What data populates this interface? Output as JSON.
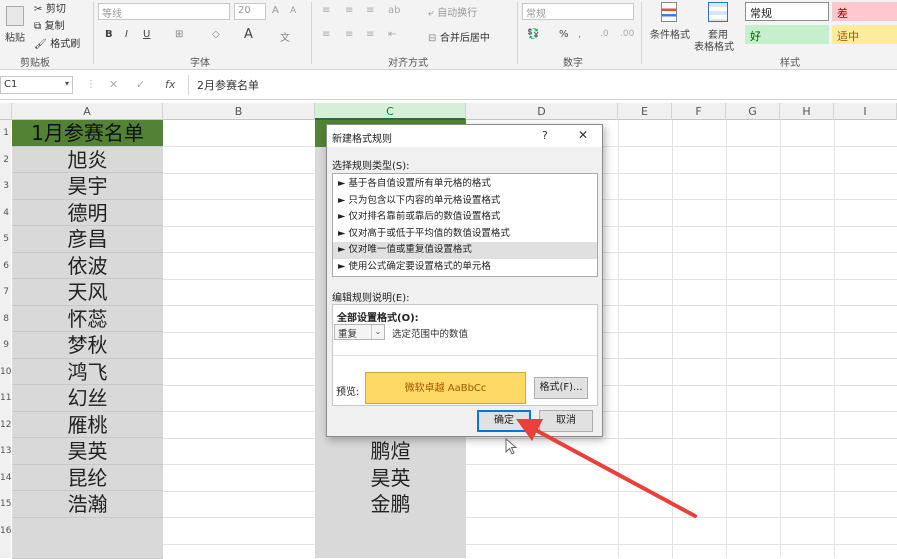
{
  "ribbon": {
    "clipboard": {
      "cut": "剪切",
      "copy": "复制",
      "format_painter": "格式刷",
      "paste": "粘贴",
      "group_label": "剪贴板"
    },
    "font": {
      "font_name": "等线",
      "font_size": "20",
      "group_label": "字体"
    },
    "alignment": {
      "wrap_text": "自动换行",
      "merge_center": "合并后居中",
      "group_label": "对齐方式"
    },
    "number": {
      "format": "常规",
      "percent": "%",
      "group_label": "数字"
    },
    "styles": {
      "conditional_formatting": "条件格式",
      "table_format_line1": "套用",
      "table_format_line2": "表格格式",
      "group_label": "样式",
      "cell_styles": [
        {
          "label": "常规",
          "bg": "#ffffff",
          "fg": "#222222"
        },
        {
          "label": "差",
          "bg": "#ffc7ce",
          "fg": "#9c0006"
        },
        {
          "label": "好",
          "bg": "#c6efce",
          "fg": "#006100"
        },
        {
          "label": "适中",
          "bg": "#ffeb9c",
          "fg": "#9c5700"
        }
      ]
    }
  },
  "formula_bar": {
    "name_box": "C1",
    "fx": "fx",
    "content": "2月参赛名单"
  },
  "columns": [
    "A",
    "B",
    "C",
    "D",
    "E",
    "F",
    "G",
    "H",
    "I"
  ],
  "rows": [
    "1",
    "2",
    "3",
    "4",
    "5",
    "6",
    "7",
    "8",
    "9",
    "10",
    "11",
    "12",
    "13",
    "14",
    "15",
    "16"
  ],
  "column_a": [
    "1月参赛名单",
    "旭炎",
    "昊宇",
    "德明",
    "彦昌",
    "依波",
    "天风",
    "怀蕊",
    "梦秋",
    "鸿飞",
    "幻丝",
    "雁桃",
    "昊英",
    "昆纶",
    "浩瀚"
  ],
  "column_c_visible": [
    "鹏煊",
    "昊英",
    "金鹏"
  ],
  "dialog": {
    "title": "新建格式规则",
    "help": "?",
    "close": "✕",
    "select_rule_type_label": "选择规则类型(S):",
    "rule_types": [
      "► 基于各自值设置所有单元格的格式",
      "► 只为包含以下内容的单元格设置格式",
      "► 仅对排名靠前或靠后的数值设置格式",
      "► 仅对高于或低于平均值的数值设置格式",
      "► 仅对唯一值或重复值设置格式",
      "► 使用公式确定要设置格式的单元格"
    ],
    "selected_rule_index": 4,
    "edit_rule_label": "编辑规则说明(E):",
    "format_all_label": "全部设置格式(O):",
    "dup_option": "重复",
    "range_text": "选定范围中的数值",
    "preview_label": "预览:",
    "preview_text": "微软卓越  AaBbCc",
    "preview_bg": "#ffd966",
    "format_button": "格式(F)...",
    "ok_button": "确定",
    "cancel_button": "取消"
  },
  "colors": {
    "header_fill": "#548235",
    "selected_col_header": "#d6efd6",
    "arrow": "#e8403a"
  }
}
